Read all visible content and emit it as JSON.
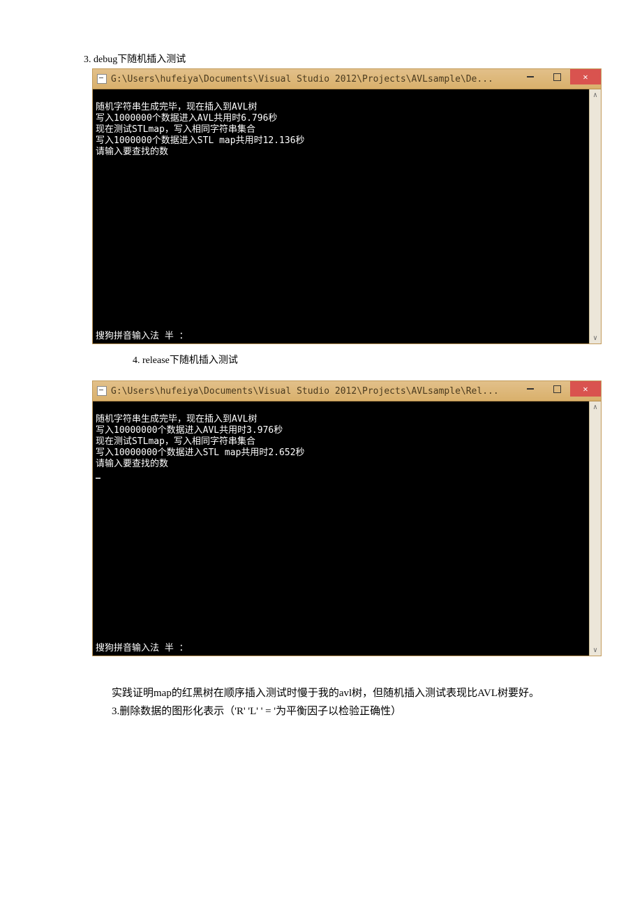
{
  "captions": {
    "c3": "3. debug下随机插入测试",
    "c4": "4. release下随机插入测试"
  },
  "window1": {
    "title": "G:\\Users\\hufeiya\\Documents\\Visual Studio 2012\\Projects\\AVLsample\\De...",
    "lines": [
      "随机字符串生成完毕，现在插入到AVL树",
      "写入1000000个数据进入AVL共用时6.796秒",
      "现在测试STLmap，写入相同字符串集合",
      "写入1000000个数据进入STL map共用时12.136秒",
      "请输入要查找的数"
    ],
    "ime": "搜狗拼音输入法 半 ："
  },
  "window2": {
    "title": "G:\\Users\\hufeiya\\Documents\\Visual Studio 2012\\Projects\\AVLsample\\Rel...",
    "lines": [
      "随机字符串生成完毕，现在插入到AVL树",
      "写入10000000个数据进入AVL共用时3.976秒",
      "现在测试STLmap，写入相同字符串集合",
      "写入10000000个数据进入STL map共用时2.652秒",
      "请输入要查找的数"
    ],
    "ime": "搜狗拼音输入法 半 ："
  },
  "paragraphs": {
    "p1": "实践证明map的红黑树在顺序插入测试时慢于我的avl树，但随机插入测试表现比AVL树要好。",
    "p2": "3.删除数据的图形化表示（'R'  'L'  ' = '为平衡因子以检验正确性）"
  }
}
